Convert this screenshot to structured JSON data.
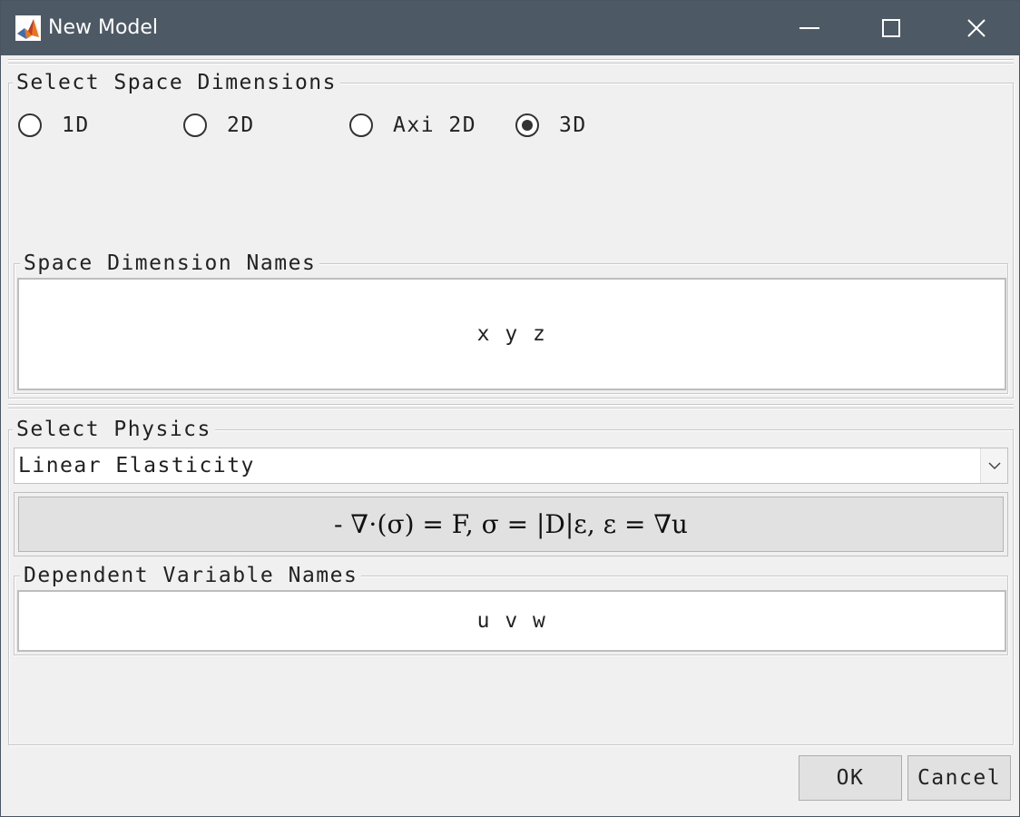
{
  "window": {
    "title": "New Model",
    "app_icon": "matlab-icon",
    "controls": [
      "minimize-icon",
      "maximize-icon",
      "close-icon"
    ]
  },
  "space_dimensions": {
    "title": "Select Space Dimensions",
    "options": [
      {
        "label": "1D",
        "selected": false
      },
      {
        "label": "2D",
        "selected": false
      },
      {
        "label": "Axi 2D",
        "selected": false
      },
      {
        "label": "3D",
        "selected": true
      }
    ]
  },
  "space_dimension_names": {
    "title": "Space Dimension Names",
    "value": "x y z"
  },
  "physics": {
    "title": "Select Physics",
    "selected": "Linear Elasticity",
    "equation": "- ∇⋅(σ) = F, σ = |D|ε, ε = ∇u"
  },
  "dependent_variable_names": {
    "title": "Dependent Variable Names",
    "value": "u v w"
  },
  "buttons": {
    "ok_label": "OK",
    "cancel_label": "Cancel"
  },
  "colors": {
    "titlebar": "#4d5a66",
    "background": "#f0f0f0",
    "field_background": "#ffffff",
    "button_background": "#e1e1e1"
  }
}
